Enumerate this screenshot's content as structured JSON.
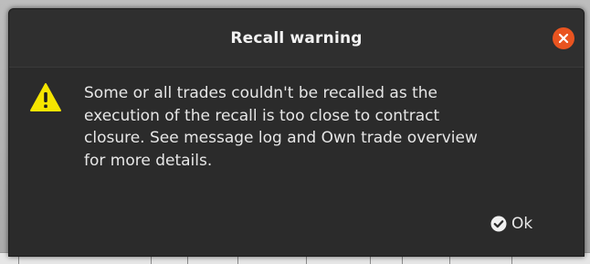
{
  "dialog": {
    "title": "Recall warning",
    "message": "Some or all trades couldn't be recalled as the\nexecution of the recall is too close to contract\nclosure. See message log and Own trade overview\nfor more details.",
    "ok_label": "Ok"
  },
  "icons": {
    "close": "close-icon",
    "warning": "warning-icon",
    "ok": "checkmark-circle-icon"
  },
  "colors": {
    "dialog_bg": "#2b2b2b",
    "close_button": "#e95420",
    "warning_fill": "#f5e500"
  }
}
